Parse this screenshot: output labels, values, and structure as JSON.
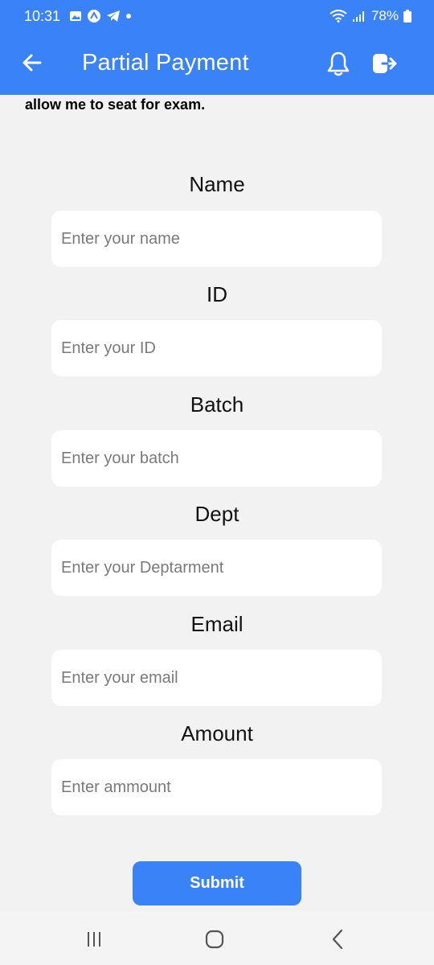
{
  "status_bar": {
    "time": "10:31",
    "battery_percent": "78%"
  },
  "app_bar": {
    "title": "Partial Payment",
    "color": "#3a82f7"
  },
  "note_text": "allow me to seat for exam.",
  "form": {
    "fields": [
      {
        "label": "Name",
        "placeholder": "Enter your name"
      },
      {
        "label": "ID",
        "placeholder": "Enter your ID"
      },
      {
        "label": "Batch",
        "placeholder": "Enter your batch"
      },
      {
        "label": "Dept",
        "placeholder": "Enter your Deptarment"
      },
      {
        "label": "Email",
        "placeholder": "Enter your email"
      },
      {
        "label": "Amount",
        "placeholder": "Enter ammount"
      }
    ],
    "submit_label": "Submit"
  },
  "icons": {
    "back": "arrow-left-icon",
    "notifications": "bell-icon",
    "logout": "logout-icon",
    "nav_recents": "recents-icon",
    "nav_home": "home-icon",
    "nav_back": "chevron-left-icon"
  }
}
